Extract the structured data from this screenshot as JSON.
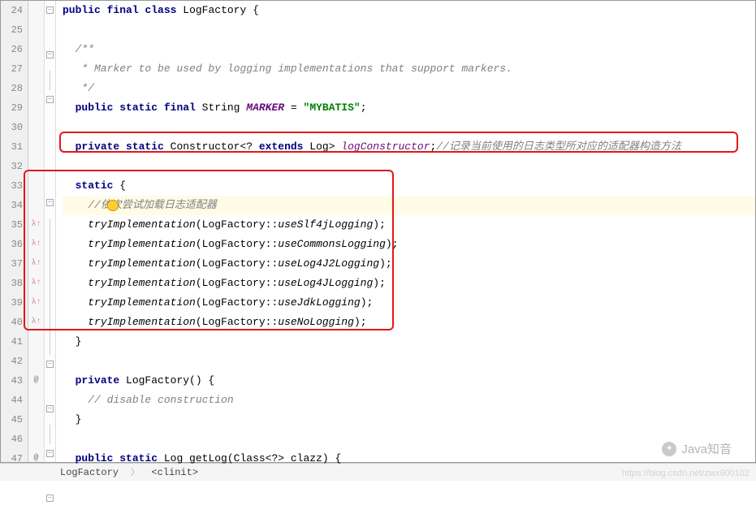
{
  "lines": {
    "start": 24,
    "end": 47
  },
  "code": {
    "l24_public": "public",
    "l24_final": "final",
    "l24_class": "class",
    "l24_name": " LogFactory {",
    "l26_doc": "/**",
    "l27_doc": " * Marker to be used by logging implementations that support markers.",
    "l28_doc": " */",
    "l29_public": "public",
    "l29_static": "static",
    "l29_final": "final",
    "l29_type": " String ",
    "l29_var": "MARKER",
    "l29_eq": " = ",
    "l29_val": "\"MYBATIS\"",
    "l29_semi": ";",
    "l31_private": "private",
    "l31_static": "static",
    "l31_type": " Constructor<? ",
    "l31_extends": "extends",
    "l31_log": " Log> ",
    "l31_var": "logConstructor",
    "l31_semi": ";",
    "l31_cmt": "//记录当前使用的日志类型所对应的适配器构造方法",
    "l33_static": "static",
    "l33_brace": " {",
    "l34_cmt": "//依次尝试加载日志适配器",
    "l35": "tryImplementation",
    "l35_arg": "(LogFactory::",
    "l35_m": "useSlf4jLogging",
    "l35_end": ");",
    "l36_m": "useCommonsLogging",
    "l37_m": "useLog4J2Logging",
    "l38_m": "useLog4JLogging",
    "l39_m": "useJdkLogging",
    "l40_m": "useNoLogging",
    "l41_brace": "}",
    "l43_private": "private",
    "l43_name": " LogFactory() {",
    "l44_cmt": "// disable construction",
    "l45_brace": "}",
    "l47_public": "public",
    "l47_static": "static",
    "l47_sig": " Log getLog(Class<?> clazz) {"
  },
  "breadcrumb": {
    "item1": "LogFactory",
    "item2": "<clinit>"
  },
  "watermark": {
    "wm1": "Java知音",
    "wm2": "https://blog.csdn.net/zwx900102"
  }
}
